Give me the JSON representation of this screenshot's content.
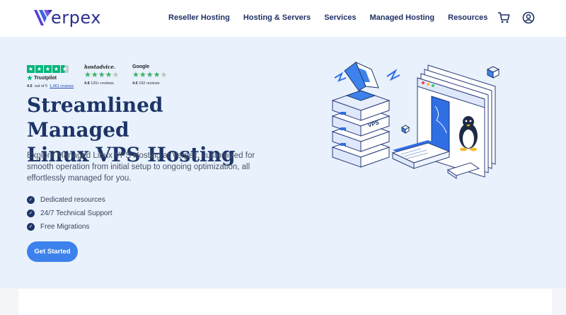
{
  "brand": {
    "name": "erpex",
    "accent": "#3d82ec",
    "navy": "#1d3466",
    "hero_bg": "#e8f1fc"
  },
  "nav": {
    "items": [
      "Reseller Hosting",
      "Hosting & Servers",
      "Services",
      "Managed Hosting",
      "Resources"
    ],
    "icons": [
      "cart-icon",
      "account-icon"
    ]
  },
  "ratings": {
    "trustpilot": {
      "name": "Trustpilot",
      "score": "4.6",
      "out_of": "out of 5",
      "reviews": "1,461 reviews",
      "stars": 4.5
    },
    "hostadvice": {
      "name": "hostadvice.",
      "score": "4.8",
      "reviews": "120+ reviews",
      "stars": 4.5
    },
    "google": {
      "name": "Google",
      "score": "4.6",
      "reviews": "192 reviews",
      "stars": 4.5
    }
  },
  "hero": {
    "title_line1": "Streamlined Managed",
    "title_line2": "Linux VPS Hosting",
    "description": "Explore Managed Linux VPS Hosting at Verpex, customized for smooth operation from initial setup to ongoing optimization, all effortlessly managed for you.",
    "features": [
      "Dedicated resources",
      "24/7 Technical Support",
      "Free Migrations"
    ],
    "cta_label": "Get Started",
    "illustration_label": "VPS"
  }
}
